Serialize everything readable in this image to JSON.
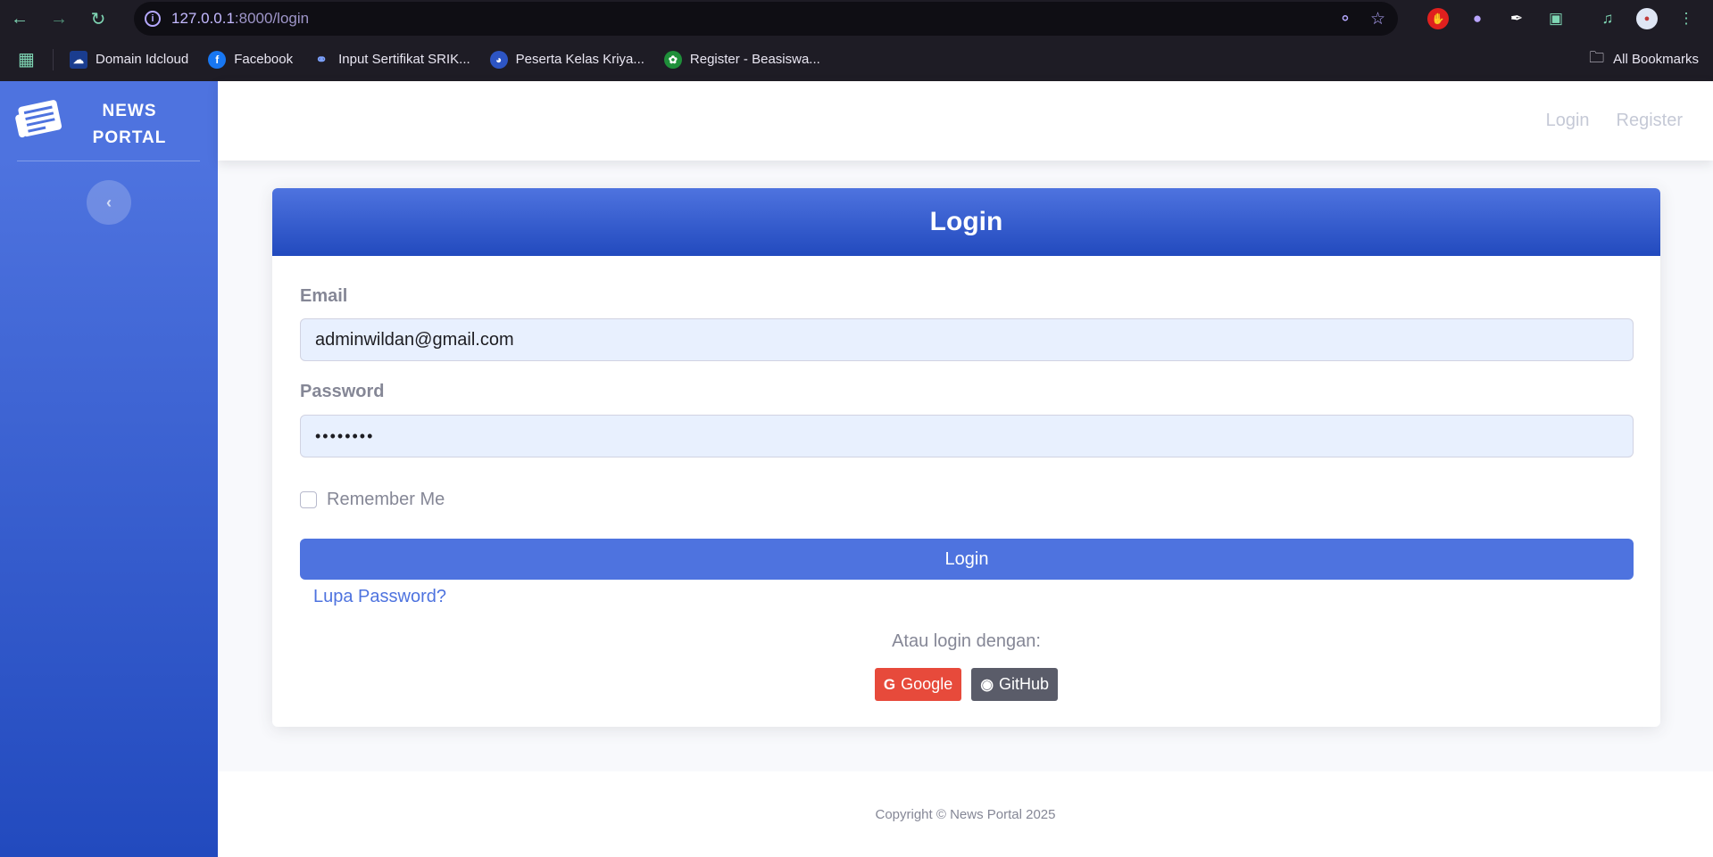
{
  "browser": {
    "url_host": "127.0.0.1",
    "url_path": ":8000/login",
    "bookmarks": [
      {
        "label": "Domain Idcloud",
        "icon": "cloud-icon",
        "color": "#1a3d8f"
      },
      {
        "label": "Facebook",
        "icon": "facebook-icon",
        "color": "#1877f2"
      },
      {
        "label": "Input Sertifikat SRIK...",
        "icon": "ribbon-icon",
        "color": "#3f6fd8"
      },
      {
        "label": "Peserta Kelas Kriya...",
        "icon": "bowl-icon",
        "color": "#2d55c4"
      },
      {
        "label": "Register - Beasiswa...",
        "icon": "emblem-icon",
        "color": "#1f8f3a"
      }
    ],
    "all_bookmarks": "All Bookmarks"
  },
  "sidebar": {
    "brand_line1": "NEWS",
    "brand_line2": "PORTAL",
    "toggle_icon": "chevron-left-icon"
  },
  "topbar": {
    "login": "Login",
    "register": "Register"
  },
  "card": {
    "title": "Login",
    "email_label": "Email",
    "email_value": "adminwildan@gmail.com",
    "password_label": "Password",
    "password_value": "••••••••",
    "remember_label": "Remember Me",
    "submit_label": "Login",
    "forgot_label": "Lupa Password?",
    "alt_text": "Atau login dengan:",
    "google_label": "Google",
    "github_label": "GitHub"
  },
  "footer": {
    "copyright": "Copyright © News Portal 2025"
  },
  "colors": {
    "primary": "#4e73df",
    "primary_dark": "#224abe",
    "google": "#e74a3b",
    "github": "#5a5c69"
  }
}
